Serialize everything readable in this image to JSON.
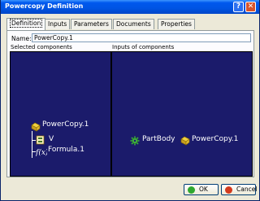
{
  "window": {
    "title": "Powercopy Definition",
    "help_label": "?",
    "close_label": "✕"
  },
  "tabs": [
    {
      "label": "Definition",
      "active": true
    },
    {
      "label": "Inputs",
      "active": false
    },
    {
      "label": "Parameters",
      "active": false
    },
    {
      "label": "Documents",
      "active": false
    },
    {
      "label": "Properties",
      "active": false
    }
  ],
  "name_field": {
    "label": "Name:",
    "value": "PowerCopy.1"
  },
  "selected_components": {
    "label": "Selected components",
    "tree": [
      {
        "label": "PowerCopy.1",
        "icon": "powercopy-icon"
      },
      {
        "label": "V",
        "icon": "parameter-icon"
      },
      {
        "label": "Formula.1",
        "icon": "formula-icon"
      }
    ]
  },
  "inputs_of_components": {
    "label": "Inputs of components",
    "nodes": [
      {
        "label": "PartBody",
        "icon": "gear-icon"
      },
      {
        "label": "PowerCopy.1",
        "icon": "powercopy-icon"
      }
    ]
  },
  "buttons": {
    "ok": "OK",
    "cancel": "Cancel"
  },
  "colors": {
    "tree_background": "#1b1b6b",
    "ok_icon": "#2fa82f",
    "cancel_icon": "#d23a1e"
  }
}
